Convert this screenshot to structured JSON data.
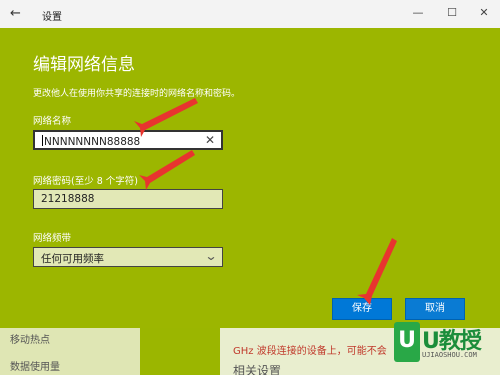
{
  "window": {
    "back_glyph": "←",
    "title": "设置",
    "minimize_glyph": "—",
    "maximize_glyph": "☐",
    "close_glyph": "✕"
  },
  "dialog": {
    "title": "编辑网络信息",
    "subtitle": "更改他人在使用你共享的连接时的网络名称和密码。",
    "name_label": "网络名称",
    "name_value": "NNNNNNNN88888",
    "password_label": "网络密码(至少 8 个字符)",
    "password_value": "21218888",
    "band_label": "网络频带",
    "band_value": "任何可用频率",
    "save_label": "保存",
    "cancel_label": "取消"
  },
  "background": {
    "sidebar_items": [
      "移动热点",
      "数据使用量"
    ],
    "notice_text": "GHz 波段连接的设备上，可能不会",
    "section_heading": "相关设置"
  },
  "watermark": {
    "mark": "U",
    "cn": "U教授",
    "en": "UJIAOSHOU.COM"
  },
  "colors": {
    "dialog_bg": "#9cb600",
    "accent": "#0078d7",
    "arrow": "#e8342f"
  }
}
